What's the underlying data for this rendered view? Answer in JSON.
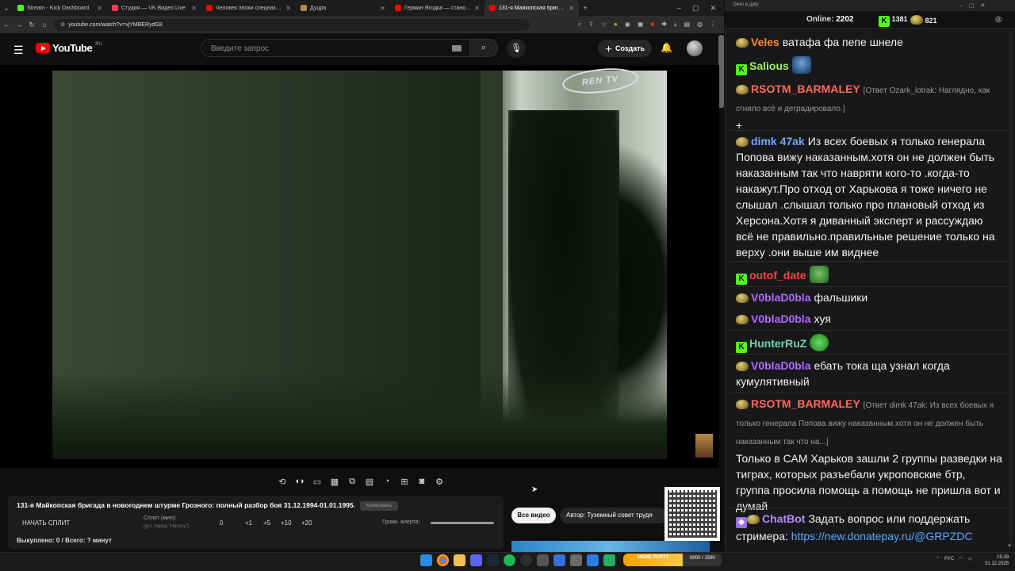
{
  "browser": {
    "tabs": [
      {
        "title": "Stream - Kick Dashboard",
        "color": "#53fc18"
      },
      {
        "title": "Студия — VK Видео Live",
        "color": "#ff3b5c"
      },
      {
        "title": "Человек эпохи спецназа. Как ...",
        "color": "#ff0000"
      },
      {
        "title": "Дуцра",
        "color": "#b08a4a"
      },
      {
        "title": "Герман Ягодка — становлени...",
        "color": "#ff0000"
      },
      {
        "title": "131-я Майкопская бригад...",
        "color": "#ff0000"
      }
    ],
    "new_tab": "+",
    "url": "youtube.com/watch?v=vjYMBERydG8"
  },
  "youtube": {
    "logo_text": "YouTube",
    "logo_region": "RU",
    "search_placeholder": "Введите запрос",
    "create_label": "Создать",
    "channel_watermark": "REN TV"
  },
  "panel": {
    "video_title": "131-я Майкопская бригада в новогоднем штурме Грозного: полный разбор боя 31.12.1994-01.01.1995.",
    "copy_label": "Копировать",
    "start_split": "НАЧАТЬ СПЛИТ",
    "split_label": "Сплит (мин):",
    "split_sub": "(уст. перед \"Начать\")",
    "split_value": "0",
    "increments": [
      "+1",
      "+5",
      "+10",
      "+20"
    ],
    "alert_volume_label": "Громк. алерта:",
    "bought": "Выкуплено: 0 / Всего: ? минут",
    "all_videos": "Все видео",
    "author": "Автор: Туземный совет трудя"
  },
  "overlay": {
    "meme_party": "MEME PARTY",
    "meme_progress": "0000 / 1500"
  },
  "taskbar": {
    "lang": "РУС",
    "time": "15:39",
    "date": "31.12.2025"
  },
  "chat": {
    "window_title": "Окно в дуку",
    "online_label": "Online:",
    "online_count": "2202",
    "kick_count": "1381",
    "other_count": "821",
    "messages": [
      {
        "user": "Veles",
        "color": "#ff8a3d",
        "text": "ватафа фа пепе шнеле",
        "reply": "",
        "badge": "coin"
      },
      {
        "user": "Salious",
        "color": "#9cf55f",
        "text": "",
        "reply": "",
        "badge": "kick"
      },
      {
        "user": "RSOTM_BARMALEY",
        "color": "#ff6b5a",
        "text": "+",
        "reply": "[Ответ Ozark_lotrak: Наглядно, как сгнило всё и деградировало.]",
        "badge": "coin"
      },
      {
        "user": "dimk 47ak",
        "color": "#6ea8ff",
        "text": "Из всех боевых я только генерала Попова вижу наказанным.хотя он не должен быть наказанным так что навряти кого-то .когда-то накажут.Про отход от Харькова я тоже ничего не слышал .слышал только про плановый отход из Херсона.Хотя я диванный эксперт и рассуждаю всё не правильно.правильные решение только на верху .они выше им виднее",
        "reply": "",
        "badge": "coin"
      },
      {
        "user": "outof_date",
        "color": "#ff4545",
        "text": "",
        "reply": "",
        "badge": "kick"
      },
      {
        "user": "V0blaD0bla",
        "color": "#b06bff",
        "text": "фальшики",
        "reply": "",
        "badge": "coin"
      },
      {
        "user": "V0blaD0bla",
        "color": "#b06bff",
        "text": "хуя",
        "reply": "",
        "badge": "coin"
      },
      {
        "user": "HunterRuZ",
        "color": "#6ad6a8",
        "text": "",
        "reply": "",
        "badge": "kick"
      },
      {
        "user": "V0blaD0bla",
        "color": "#b06bff",
        "text": "ебать тока ща узнал когда кумулятивный",
        "reply": "",
        "badge": "coin"
      },
      {
        "user": "RSOTM_BARMALEY",
        "color": "#ff6b5a",
        "text": "Только в САМ Харьков зашли 2 группы разведки на тиграх, которых разъебали укроповские бтр, группа просила помощь а помощь не пришла вот и думай",
        "reply": "[Ответ dimk 47ak: Из всех боевых я только генерала Попова вижу наказанным.хотя он не должен быть наказанным так что на...]",
        "badge": "coin"
      },
      {
        "user": "ChatBot",
        "color": "#b98cff",
        "text": "Задать вопрос или поддержать стримера: ",
        "link": "https://new.donatepay.ru/@GRPZDC",
        "reply": "",
        "badge": "bot"
      }
    ]
  }
}
